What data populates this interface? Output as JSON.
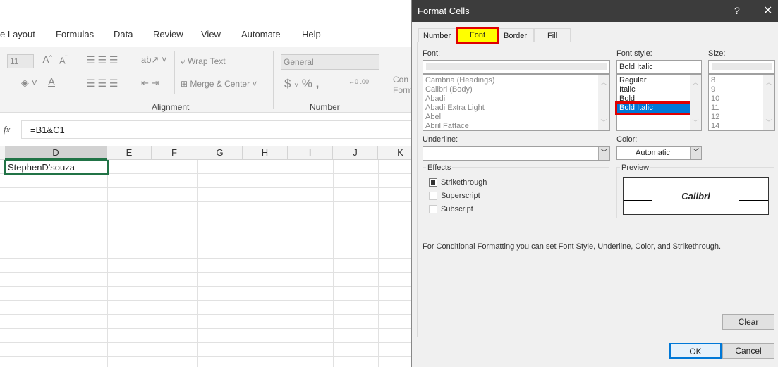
{
  "ribbon": {
    "tabs": [
      "e Layout",
      "Formulas",
      "Data",
      "Review",
      "View",
      "Automate",
      "Help"
    ],
    "font_size": "11",
    "wrap_text": "Wrap Text",
    "merge_center": "Merge & Center",
    "number_format": "General",
    "group_alignment": "Alignment",
    "group_number": "Number",
    "cond_format": "Con",
    "cond_format2": "Form"
  },
  "formula_bar": {
    "fx": "fx",
    "formula": "=B1&C1"
  },
  "sheet": {
    "columns": [
      "D",
      "E",
      "F",
      "G",
      "H",
      "I",
      "J",
      "K"
    ],
    "cell_d1": "StephenD'souza"
  },
  "dialog": {
    "title": "Format Cells",
    "help": "?",
    "close": "✕",
    "tabs": [
      "Number",
      "Font",
      "Border",
      "Fill"
    ],
    "active_tab": "Font",
    "font_label": "Font:",
    "font_value": "",
    "fonts": [
      "Cambria (Headings)",
      "Calibri (Body)",
      "Abadi",
      "Abadi Extra Light",
      "Abel",
      "Abril Fatface"
    ],
    "style_label": "Font style:",
    "style_value": "Bold Italic",
    "styles": [
      "Regular",
      "Italic",
      "Bold",
      "Bold Italic"
    ],
    "selected_style": "Bold Italic",
    "size_label": "Size:",
    "size_value": "",
    "sizes": [
      "8",
      "9",
      "10",
      "11",
      "12",
      "14"
    ],
    "underline_label": "Underline:",
    "underline_value": "",
    "color_label": "Color:",
    "color_value": "Automatic",
    "effects_label": "Effects",
    "effects": [
      {
        "label": "Strikethrough",
        "checked": "indeterminate"
      },
      {
        "label": "Superscript",
        "checked": false
      },
      {
        "label": "Subscript",
        "checked": false
      }
    ],
    "preview_label": "Preview",
    "preview_text": "Calibri",
    "note": "For Conditional Formatting you can set Font Style, Underline, Color, and Strikethrough.",
    "clear": "Clear",
    "ok": "OK",
    "cancel": "Cancel"
  },
  "colors": {
    "highlight": "#ffff00",
    "callout": "#e00000",
    "selection": "#0078d7",
    "cell_border": "#217346"
  }
}
